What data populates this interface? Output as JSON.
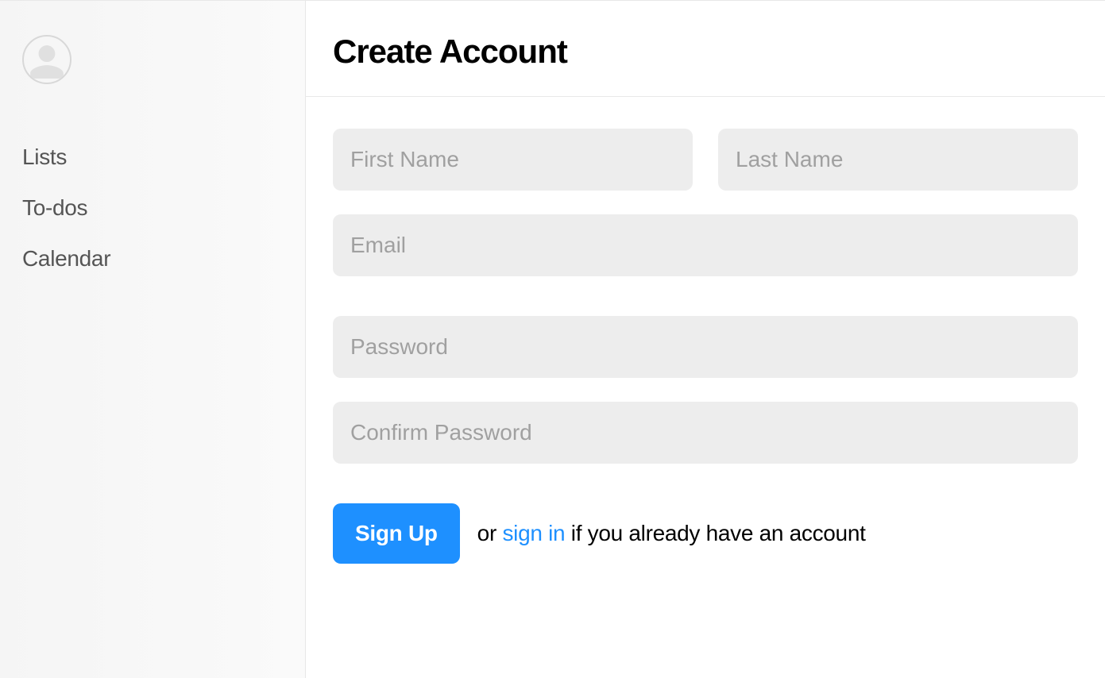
{
  "sidebar": {
    "nav": [
      {
        "label": "Lists"
      },
      {
        "label": "To-dos"
      },
      {
        "label": "Calendar"
      }
    ]
  },
  "header": {
    "title": "Create Account"
  },
  "form": {
    "first_name": {
      "placeholder": "First Name",
      "value": ""
    },
    "last_name": {
      "placeholder": "Last Name",
      "value": ""
    },
    "email": {
      "placeholder": "Email",
      "value": ""
    },
    "password": {
      "placeholder": "Password",
      "value": ""
    },
    "confirm_password": {
      "placeholder": "Confirm Password",
      "value": ""
    }
  },
  "actions": {
    "submit_label": "Sign Up",
    "alt_prefix": "or ",
    "signin_link": "sign in",
    "alt_suffix": " if you already have an account"
  }
}
